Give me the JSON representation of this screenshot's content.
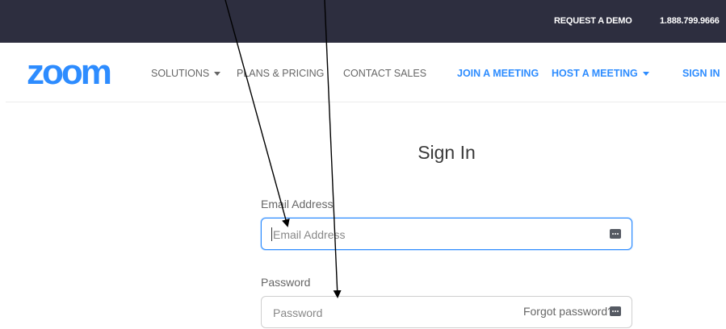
{
  "topbar": {
    "request_demo": "REQUEST A DEMO",
    "phone": "1.888.799.9666"
  },
  "header": {
    "logo": "zoom",
    "nav": {
      "solutions": "SOLUTIONS",
      "plans_pricing": "PLANS & PRICING",
      "contact_sales": "CONTACT SALES",
      "join_meeting": "JOIN A MEETING",
      "host_meeting": "HOST A MEETING",
      "sign_in": "SIGN IN"
    }
  },
  "form": {
    "title": "Sign In",
    "email_label": "Email Address",
    "email_placeholder": "Email Address",
    "email_value": "",
    "password_label": "Password",
    "password_placeholder": "Password",
    "password_value": "",
    "forgot_password": "Forgot password?",
    "field_icon": "password-manager-key-icon"
  },
  "colors": {
    "topbar_bg": "#2d2e3f",
    "brand_blue": "#2d8cff",
    "nav_gray": "#666666",
    "annotation_arrow": "#000000"
  }
}
